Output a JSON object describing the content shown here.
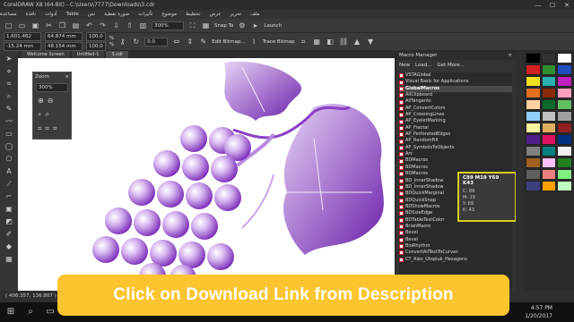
{
  "window": {
    "title": "CorelDRAW X8 (64-Bit) - C:\\Users\\7777\\Downloads\\3.cdr",
    "controls": [
      "—",
      "☐",
      "✕"
    ]
  },
  "menu": [
    "ملف",
    "تحرير",
    "عرض",
    "تخطيط",
    "موضوع",
    "تأثيرات",
    "صورة نقطية",
    "نص",
    "Table",
    "أدوات",
    "نافذة",
    "مساعدة"
  ],
  "property_bar": {
    "x": "1,601.462 mm",
    "y": "-15.24 mm",
    "width": "64.874 mm",
    "height": "48.154 mm",
    "scale_w": "100.0",
    "scale_h": "100.0",
    "unit": "%",
    "rotation": "0.0",
    "zoom": "300%",
    "snap_to": "Snap To",
    "launch": "Launch",
    "edit_bitmap": "Edit Bitmap...",
    "trace_bitmap": "Trace Bitmap"
  },
  "tabs": [
    "Welcome Screen",
    "Untitled-1",
    "3.cdr"
  ],
  "zoom_docker": {
    "title": "Zoom",
    "value": "300%"
  },
  "macro_manager": {
    "title": "Macro Manager",
    "new_label": "New",
    "load_label": "Load...",
    "get_more_label": "Get More...",
    "tree": [
      "VSTAGlobal",
      "Visual Basic for Applications",
      "GlobalMacros",
      "AllClipboard",
      "AllTangents",
      "AP_ConvertColors",
      "AP_CrossingLines",
      "AP_EyeletMarking",
      "AP_Fractal",
      "AP_PerforatedEdges",
      "AP_RandomFill",
      "AP_SymbolsToObjects",
      "Arc",
      "BDMacros",
      "BDMacros",
      "BDMacros",
      "BD_InnerShadow",
      "BD_InnerShadow",
      "BDQuickMarginal",
      "BDQuickSnap",
      "BDShowMacros",
      "BDSizeEdge",
      "BDTableTextColor",
      "BrianMacro",
      "Bevel",
      "Bevel",
      "BioRhythm",
      "ConvertAllTextToCurves",
      "CT_Alex_Utopiuk_Hexagons"
    ]
  },
  "color_tooltip": {
    "title": "C89 M19 Y69 K43",
    "c": "C: 89",
    "m": "M: 19",
    "y": "Y: 69",
    "k": "K: 43"
  },
  "palette_colors": [
    "#000000",
    "#333333",
    "#ffffff",
    "#d42020",
    "#2f8f2f",
    "#1f4fbf",
    "#f0e020",
    "#2cb0b0",
    "#c020c0",
    "#e07020",
    "#8a2a0a",
    "#ff9fc0",
    "#ffd0a0",
    "#0a6a2a",
    "#60c060",
    "#90d0ff",
    "#c0c0c0",
    "#a0a0a0",
    "#f6f6a0",
    "#e0b060",
    "#902020",
    "#50208a",
    "#e01060",
    "#003080",
    "#808080",
    "#008080",
    "#f0f0f0",
    "#a06020",
    "#ffc0ff",
    "#208020",
    "#606060",
    "#f08080",
    "#80f080",
    "#404080",
    "#ffa000",
    "#c0ffc0"
  ],
  "status": {
    "coords": "( 406.357, 136.807 )"
  },
  "taskbar": {
    "time": "4:57 PM",
    "date": "1/20/2017"
  },
  "banner": {
    "text": "Click on Download Link from Description",
    "color": "#fcc42e"
  }
}
